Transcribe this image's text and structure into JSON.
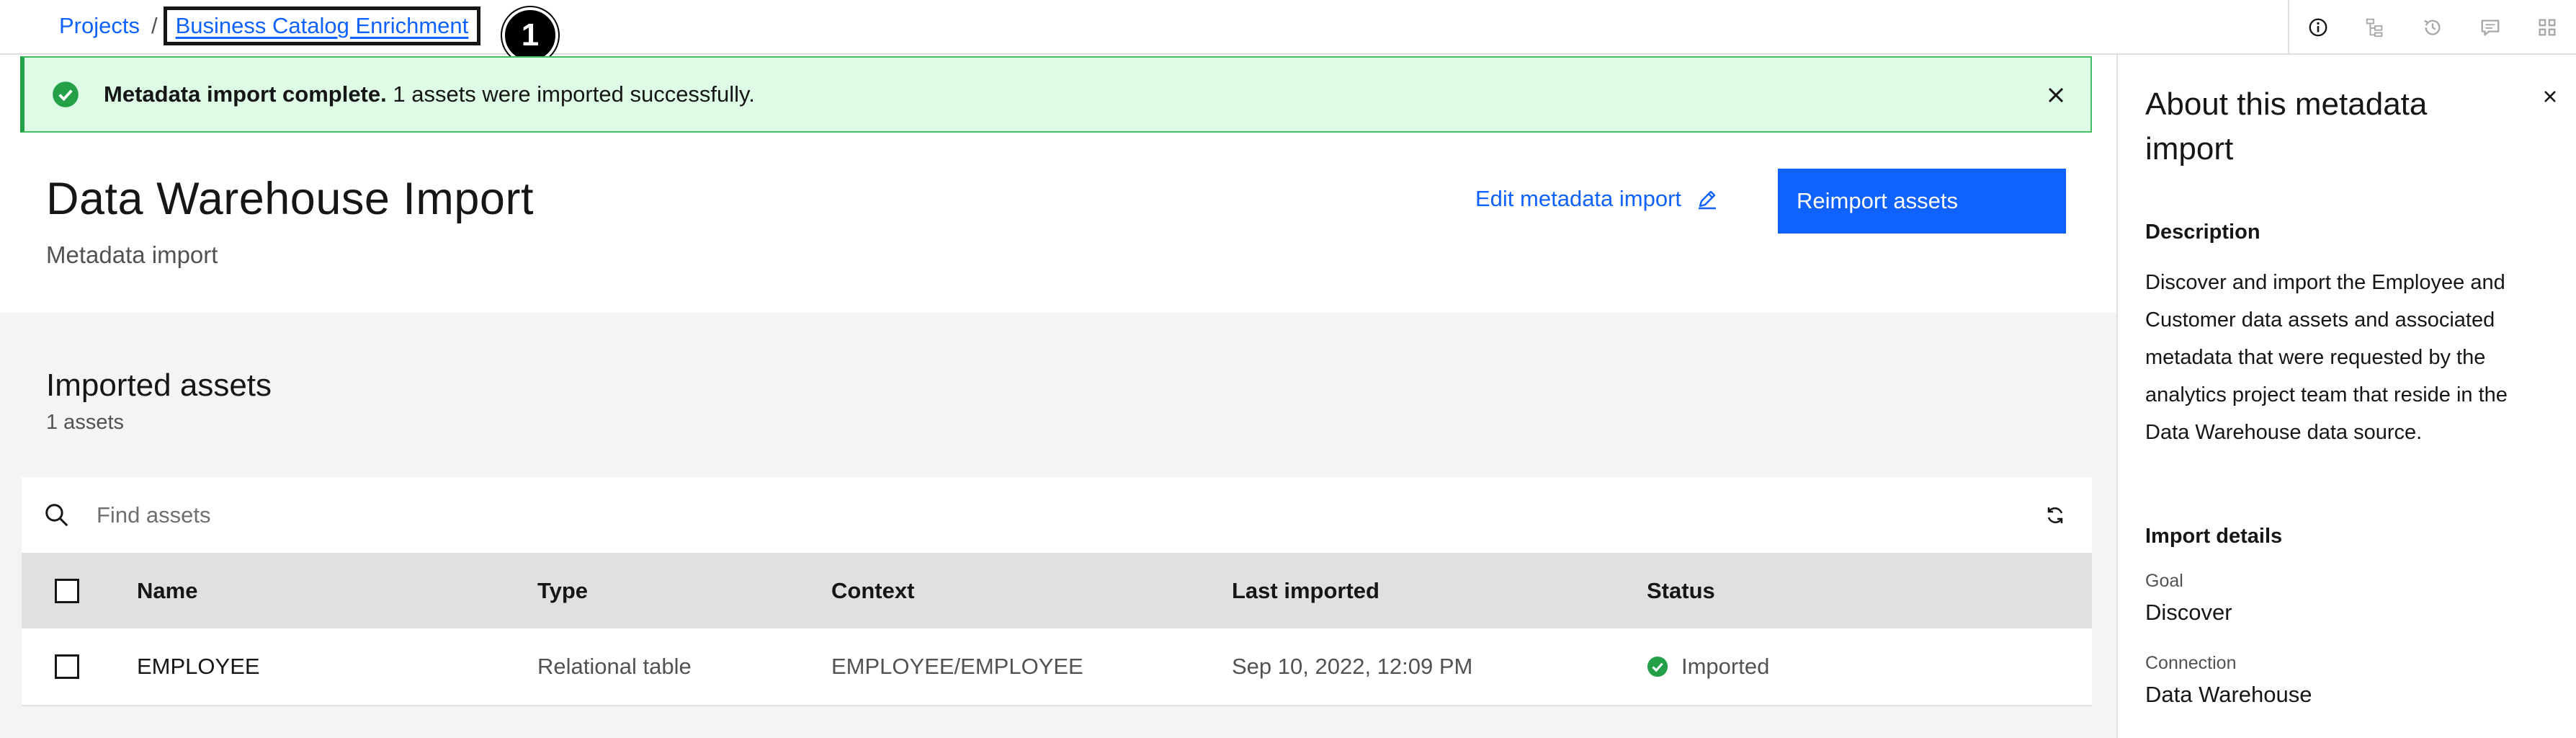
{
  "breadcrumb": {
    "projects": "Projects",
    "separator": "/",
    "current": "Business Catalog Enrichment"
  },
  "step_badge": "1",
  "toolbar": {
    "icons": [
      "info-icon",
      "lineage-icon",
      "history-icon",
      "comment-icon",
      "apps-icon"
    ]
  },
  "notification": {
    "title": "Metadata import complete.",
    "message": " 1 assets were imported successfully."
  },
  "header": {
    "title": "Data Warehouse Import",
    "subtitle": "Metadata import",
    "edit_label": "Edit metadata import",
    "reimport_label": "Reimport assets"
  },
  "assets": {
    "title": "Imported assets",
    "count": "1 assets",
    "search_placeholder": "Find assets",
    "columns": [
      "Name",
      "Type",
      "Context",
      "Last imported",
      "Status"
    ],
    "rows": [
      {
        "name": "EMPLOYEE",
        "type": "Relational table",
        "context": "EMPLOYEE/EMPLOYEE",
        "last_imported": "Sep 10, 2022, 12:09 PM",
        "status": "Imported"
      }
    ]
  },
  "panel": {
    "title": "About this metadata import",
    "description_heading": "Description",
    "description": "Discover and import the Employee and Customer data assets and associated metadata that were requested by the analytics project team that reside in the Data Warehouse data source.",
    "details_heading": "Import details",
    "goal_label": "Goal",
    "goal_value": "Discover",
    "connection_label": "Connection",
    "connection_value": "Data Warehouse"
  },
  "colors": {
    "primary": "#0f62fe",
    "success": "#24a148",
    "success_bg": "#defbe6"
  }
}
